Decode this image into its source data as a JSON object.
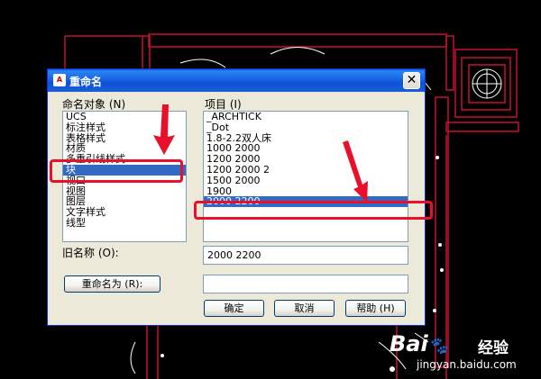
{
  "dialog": {
    "title": "重命名",
    "app_icon": "A",
    "close_label": "✕",
    "object_list_label": "命名对象 (N)",
    "object_items": [
      "UCS",
      "标注样式",
      "表格样式",
      "材质",
      "多重引线样式",
      "块",
      "视口",
      "视图",
      "图层",
      "文字样式",
      "线型"
    ],
    "object_selected": "块",
    "items_label": "项目 (I)",
    "item_list": [
      "_ARCHTICK",
      "_Dot",
      "1.8-2.2双人床",
      "1000 2000",
      "1200 2000",
      "1200 2000 2",
      "1500 2000",
      "1900",
      "2000 2200"
    ],
    "item_selected": "2000 2200",
    "old_name_label": "旧名称 (O):",
    "old_name_value": "2000 2200",
    "rename_button": "重命名为 (R):",
    "rename_value": "",
    "ok_button": "确定",
    "cancel_button": "取消",
    "help_button": "帮助 (H)"
  },
  "watermark": {
    "brand": "Bai",
    "paw": "🐾",
    "brand_suffix": "经验",
    "url": "jingyan.baidu.com"
  },
  "colors": {
    "annotation_red": "#e8102a",
    "selection_blue": "#316ac5",
    "cad_line_red": "#c8102e"
  }
}
